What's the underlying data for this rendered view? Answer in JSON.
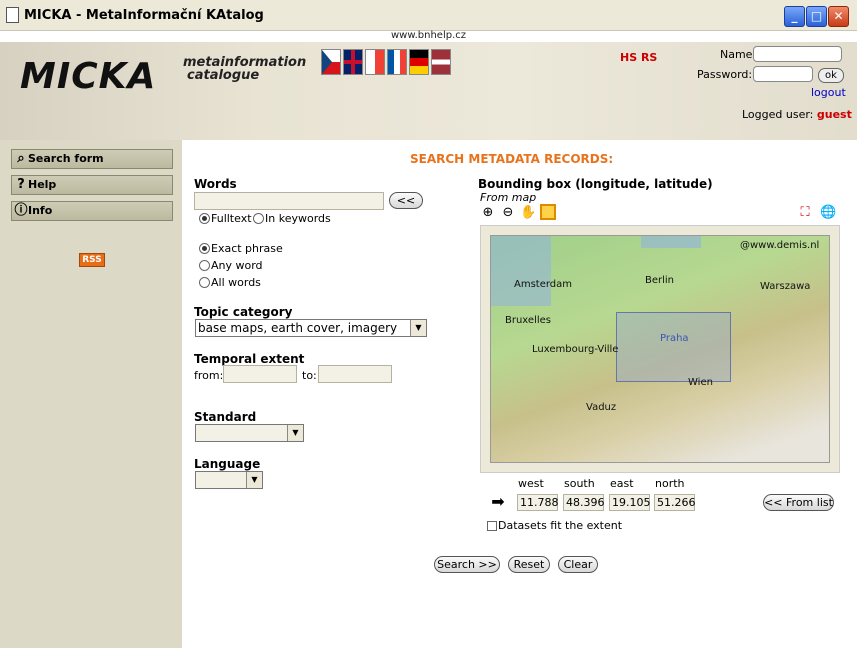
{
  "window": {
    "title": "MICKA - MetaInformační KAtalog",
    "url": "www.bnhelp.cz"
  },
  "header": {
    "logo": "MICKA",
    "logo_sub1": "metainformation",
    "logo_sub2": "catalogue",
    "partner_logo": "HS RS",
    "name_label": "Name:",
    "password_label": "Password:",
    "ok_label": "ok",
    "logout_label": "logout",
    "logged_user_label": "Logged user:",
    "logged_user": "guest",
    "flags": [
      "cz",
      "gb",
      "fr",
      "fr2",
      "de",
      "lv"
    ]
  },
  "sidebar": {
    "items": [
      {
        "label": "Search form",
        "icon": "search-form-icon"
      },
      {
        "label": "Help",
        "icon": "question-icon"
      },
      {
        "label": "Info",
        "icon": "info-icon"
      }
    ],
    "rss": "RSS"
  },
  "form": {
    "heading": "SEARCH METADATA RECORDS:",
    "words_label": "Words",
    "words_value": "",
    "words_btn": "<<",
    "fulltext": "Fulltext",
    "in_keywords": "In keywords",
    "exact_phrase": "Exact phrase",
    "any_word": "Any word",
    "all_words": "All words",
    "topic_label": "Topic category",
    "topic_value": "base maps, earth cover, imagery",
    "temporal_label": "Temporal extent",
    "from_label": "from:",
    "to_label": "to:",
    "standard_label": "Standard",
    "standard_value": "",
    "language_label": "Language",
    "language_value": ""
  },
  "map": {
    "title": "Bounding box (longitude, latitude)",
    "subtitle": "From map",
    "credit": "@www.demis.nl",
    "cities": [
      "Amsterdam",
      "Berlin",
      "Warszawa",
      "Bruxelles",
      "Praha",
      "Luxembourg-Ville",
      "Wien",
      "Vaduz"
    ],
    "west_label": "west",
    "south_label": "south",
    "east_label": "east",
    "north_label": "north",
    "west": "11.788",
    "south": "48.396",
    "east": "19.105",
    "north": "51.266",
    "from_list": "<< From list",
    "fit_label": "Datasets fit the extent"
  },
  "actions": {
    "search": "Search >>",
    "reset": "Reset",
    "clear": "Clear"
  }
}
